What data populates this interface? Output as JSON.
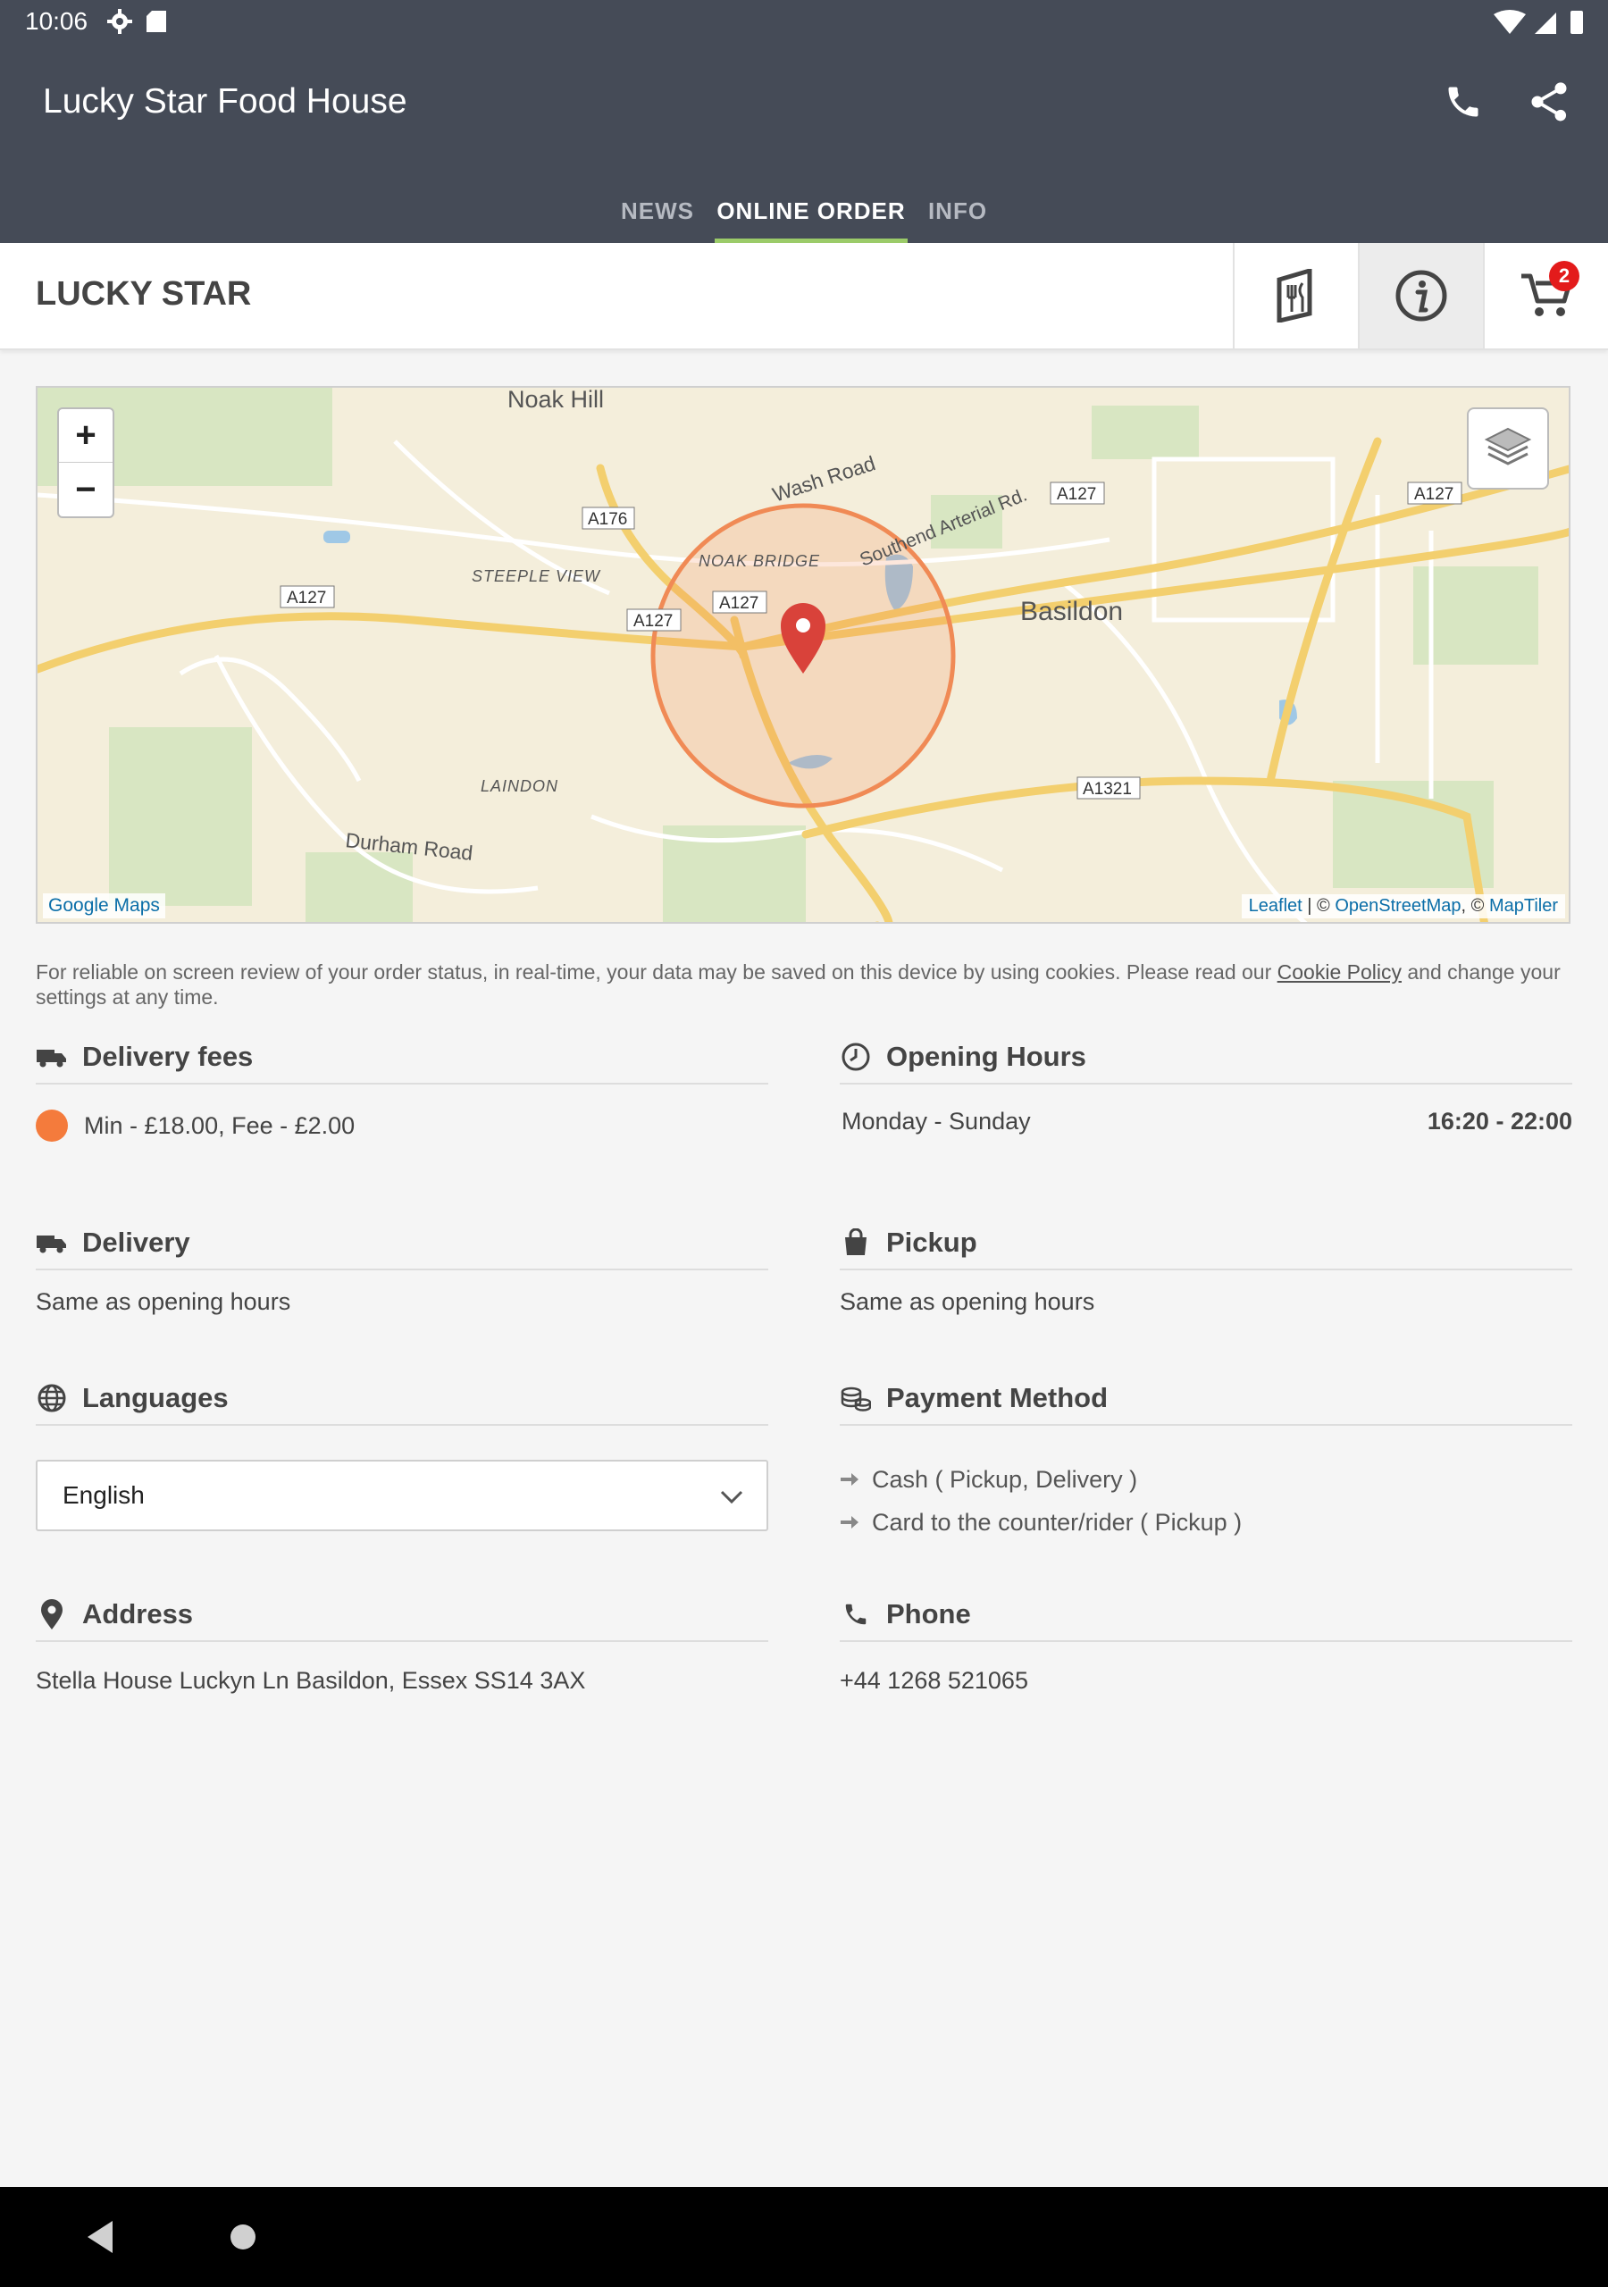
{
  "status_bar": {
    "time": "10:06",
    "icons": [
      "settings-icon",
      "sd-card-icon",
      "wifi-icon",
      "signal-icon",
      "battery-icon"
    ]
  },
  "app_bar": {
    "title": "Lucky Star Food House",
    "tabs": [
      {
        "label": "NEWS",
        "active": false
      },
      {
        "label": "ONLINE ORDER",
        "active": true
      },
      {
        "label": "INFO",
        "active": false
      }
    ],
    "accent": "#9bcb69"
  },
  "restaurant": {
    "name": "LUCKY STAR",
    "cart_count": "2"
  },
  "map": {
    "labels": {
      "noak_hill": "Noak Hill",
      "wash_road": "Wash Road",
      "southend": "Southend Arterial Rd.",
      "noak_bridge": "NOAK BRIDGE",
      "steeple_view": "STEEPLE VIEW",
      "basildon": "Basildon",
      "laindon": "LAINDON",
      "durham": "Durham Road",
      "a176": "A176",
      "a127": "A127",
      "a1321": "A1321"
    },
    "zoom_in": "+",
    "zoom_out": "−",
    "attribution_left": "Google Maps",
    "attribution_right": {
      "leaflet": "Leaflet",
      "sep1": " | © ",
      "osm": "OpenStreetMap",
      "sep2": ", © ",
      "maptiler": "MapTiler"
    }
  },
  "cookie": {
    "text_before": "For reliable on screen review of your order status, in real-time, your data may be saved on this device by using cookies. Please read our ",
    "link": "Cookie Policy",
    "text_after": " and change your settings at any time."
  },
  "sections": {
    "delivery_fees": {
      "title": "Delivery fees",
      "entry": "Min - £18.00, Fee - £2.00",
      "dot_color": "#f47b3c"
    },
    "opening_hours": {
      "title": "Opening Hours",
      "days": "Monday - Sunday",
      "time": "16:20 - 22:00"
    },
    "delivery": {
      "title": "Delivery",
      "text": "Same as opening hours"
    },
    "pickup": {
      "title": "Pickup",
      "text": "Same as opening hours"
    },
    "languages": {
      "title": "Languages",
      "selected": "English"
    },
    "payment": {
      "title": "Payment Method",
      "methods": [
        "Cash ( Pickup, Delivery )",
        "Card to the counter/rider ( Pickup )"
      ]
    },
    "address": {
      "title": "Address",
      "text": "Stella House Luckyn Ln Basildon, Essex SS14 3AX"
    },
    "phone": {
      "title": "Phone",
      "text": "+44 1268 521065"
    }
  }
}
